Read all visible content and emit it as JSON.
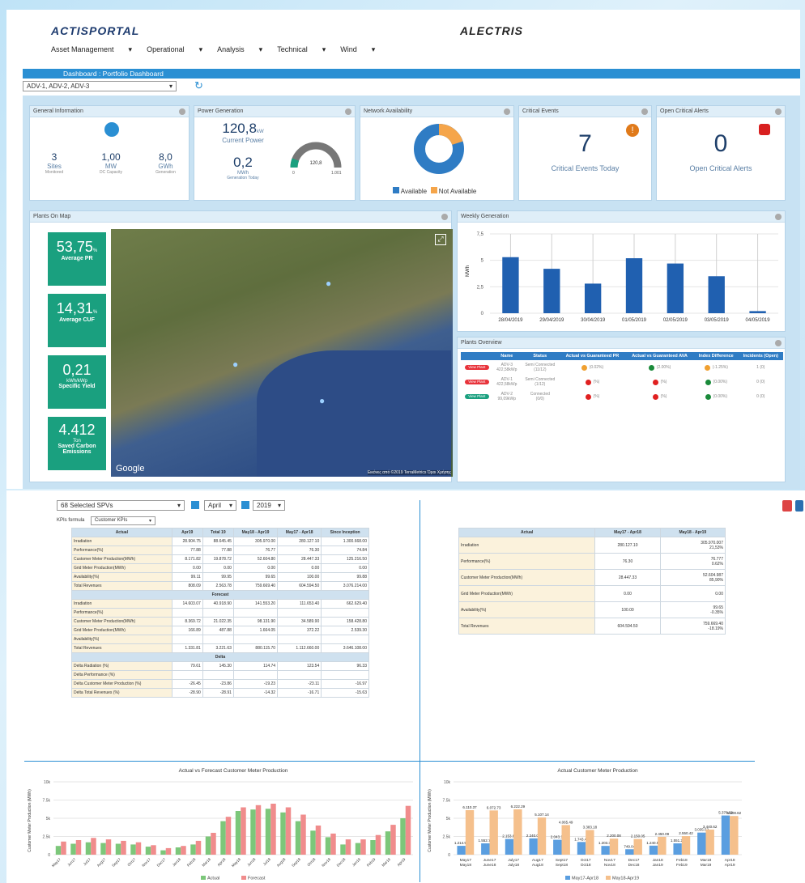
{
  "header": {
    "logo_left": "ACTISPORTAL",
    "logo_right": "ALECTRIS",
    "nav": [
      "Asset Management",
      "Operational",
      "Analysis",
      "Technical",
      "Wind"
    ],
    "breadcrumb": "Dashboard : Portfolio Dashboard",
    "portfolio_select": "ADV-1, ADV-2, ADV-3"
  },
  "general": {
    "title": "General Information",
    "sites": "3",
    "sites_lbl": "Sites",
    "sites_sub": "Monitored",
    "mw": "1,00",
    "mw_lbl": "MW",
    "mw_sub": "DC Capacity",
    "gwh": "8,0",
    "gwh_lbl": "GWh",
    "gwh_sub": "Generation"
  },
  "power": {
    "title": "Power Generation",
    "current": "120,8",
    "current_unit": "kW",
    "current_lbl": "Current Power",
    "today": "0,2",
    "today_unit": "MWh",
    "today_lbl": "Generation Today",
    "gauge_val": "120,8",
    "gauge_min": "0",
    "gauge_max": "1.001",
    "gauge_level": 0.12
  },
  "network": {
    "title": "Network Availability",
    "available": "Available",
    "not_available": "Not Available",
    "available_share": 0.8
  },
  "critical": {
    "title": "Critical Events",
    "value": "7",
    "label": "Critical Events Today"
  },
  "alerts": {
    "title": "Open Critical Alerts",
    "value": "0",
    "label": "Open Critical Alerts"
  },
  "map": {
    "title": "Plants On Map",
    "google": "Google",
    "attribution": "Εικόνες από ©2019 TerraMetrics  Όροι Χρήσης"
  },
  "kpis": [
    {
      "value": "53,75",
      "unit": "%",
      "label": "Average PR"
    },
    {
      "value": "14,31",
      "unit": "%",
      "label": "Average CUF"
    },
    {
      "value": "0,21",
      "unit": "kWh/kWp",
      "label": "Specific Yield"
    },
    {
      "value": "4.412",
      "unit": "Ton",
      "label": "Saved Carbon Emissions"
    }
  ],
  "weekly": {
    "title": "Weekly Generation",
    "ylabel": "MWh"
  },
  "overview": {
    "title": "Plants Overview",
    "headers": [
      "",
      "Name",
      "Status",
      "Actual vs Guaranteed PR",
      "Actual vs Guaranteed AVA",
      "Index Difference",
      "Incidents (Open)"
    ],
    "rows": [
      {
        "btn": "View Plant",
        "btn_color": "#e8333b",
        "name": "ADV-3\n422,58kWp",
        "status": "Semi Connected\n(11/12)",
        "pr": "(0.02%)",
        "pr_c": "#f0a030",
        "ava": "(2.00%)",
        "ava_c": "#1a8a3a",
        "idx": "(-1.25%)",
        "idx_c": "#f0a030",
        "inc": "1 (0)"
      },
      {
        "btn": "View Plant",
        "btn_color": "#e8333b",
        "name": "ADV-1\n422,58kWp",
        "status": "Semi Connected\n(1/12)",
        "pr": "(%)",
        "pr_c": "#e02020",
        "ava": "(%)",
        "ava_c": "#e02020",
        "idx": "(0.00%)",
        "idx_c": "#1a8a3a",
        "inc": "0 (0)"
      },
      {
        "btn": "View Plant",
        "btn_color": "#1aa07f",
        "name": "ADV-2\n99,09kWp",
        "status": "Connected\n(0/0)",
        "pr": "(%)",
        "pr_c": "#e02020",
        "ava": "(%)",
        "ava_c": "#e02020",
        "idx": "(0.00%)",
        "idx_c": "#1a8a3a",
        "inc": "0 (0)"
      }
    ]
  },
  "filters": {
    "spvs": "68 Selected SPVs",
    "month": "April",
    "year": "2019",
    "kpi_formula_lbl": "KPIs formula",
    "kpi_formula": "Customer KPIs"
  },
  "left_table": {
    "headers": [
      "Actual",
      "Apr19",
      "Total 19",
      "May18 - Apr19",
      "May17 - Apr18",
      "Since Inception"
    ],
    "actual": [
      [
        "Irradiation",
        "28.904.75",
        "88.645.45",
        "305.970.00",
        "280.127.10",
        "1.300.668.00"
      ],
      [
        "Performance(%)",
        "77.88",
        "77.88",
        "76.77",
        "76.30",
        "74.84"
      ],
      [
        "Customer Meter Production(MWh)",
        "8.171.82",
        "19.878.72",
        "52.604.80",
        "28.447.33",
        "125.216.50"
      ],
      [
        "Grid Meter Production(MWh)",
        "0.00",
        "0.00",
        "0.00",
        "0.00",
        "0.00"
      ],
      [
        "Availability(%)",
        "99.11",
        "99.95",
        "99.65",
        "100.00",
        "99.88"
      ],
      [
        "Total Revenues",
        "808.09",
        "2.563.78",
        "759.669.40",
        "604.594.50",
        "3.076.214.00"
      ]
    ],
    "forecast_lbl": "Forecast",
    "forecast": [
      [
        "Irradiation",
        "14.603.07",
        "40.918.90",
        "141.553.20",
        "111.653.40",
        "662.629.40"
      ],
      [
        "Performance(%)",
        "",
        "",
        "",
        "",
        ""
      ],
      [
        "Customer Meter Production(MWh)",
        "8.369.72",
        "21.022.35",
        "98.131.90",
        "34.589.90",
        "158.428.80"
      ],
      [
        "Grid Meter Production(MWh)",
        "166.89",
        "487.88",
        "1.664.05",
        "372.22",
        "2.539.30"
      ],
      [
        "Availability(%)",
        "",
        "",
        "",
        "",
        ""
      ],
      [
        "Total Revenues",
        "1.331.81",
        "3.221.63",
        "880.115.70",
        "1.112.660.00",
        "3.646.108.00"
      ]
    ],
    "delta_lbl": "Delta",
    "delta": [
      [
        "Delta Radiation (%)",
        "79.61",
        "145.30",
        "114.74",
        "123.54",
        "96.33"
      ],
      [
        "Delta Performance (%)",
        "",
        "",
        "",
        "",
        ""
      ],
      [
        "Delta Customer Meter Production (%)",
        "-26.45",
        "-23.86",
        "-19.23",
        "-23.11",
        "-16.97"
      ],
      [
        "Delta Total Revenues (%)",
        "-28.90",
        "-28.91",
        "-14.32",
        "-16.71",
        "-15.63"
      ]
    ]
  },
  "right_table": {
    "headers": [
      "Actual",
      "May17 - Apr18",
      "May18 - Apr19"
    ],
    "rows": [
      [
        "Irradiation",
        "280.127.10",
        "305.970.007\n21,53%"
      ],
      [
        "Performance(%)",
        "76.30",
        "76.777\n0.62%"
      ],
      [
        "Customer Meter Production(MWh)",
        "28.447.33",
        "52.604.987\n85,90%"
      ],
      [
        "Grid Meter Production(MWh)",
        "0.00",
        "0.00"
      ],
      [
        "Availability(%)",
        "100.00",
        "99.65\n-0.35%"
      ],
      [
        "Total Revenues",
        "604.594.50",
        "759.669.40\n-18.19%"
      ]
    ]
  },
  "chart_data": [
    {
      "type": "bar",
      "title": "",
      "ylabel": "MWh",
      "categories": [
        "28/04/2019",
        "29/04/2019",
        "30/04/2019",
        "01/05/2019",
        "02/05/2019",
        "03/05/2019",
        "04/05/2019"
      ],
      "values": [
        5.3,
        4.2,
        2.8,
        5.2,
        4.7,
        3.5,
        0.2
      ],
      "ylim": [
        0,
        7.5
      ],
      "yticks": [
        "0",
        "2,5",
        "5",
        "7,5"
      ]
    },
    {
      "type": "bar",
      "title": "Actual vs Forecast Customer Meter Production",
      "ylabel": "Customer Meter Production (MWh)",
      "categories": [
        "May17",
        "Jun17",
        "Jul17",
        "Aug17",
        "Sep17",
        "Oct17",
        "Nov17",
        "Dec17",
        "Jan18",
        "Feb18",
        "Mar18",
        "Apr18",
        "May18",
        "Jun18",
        "Jul18",
        "Aug18",
        "Sep18",
        "Oct18",
        "Nov18",
        "Dec18",
        "Jan19",
        "Feb19",
        "Mar19",
        "Apr19"
      ],
      "ylim": [
        0,
        10000
      ],
      "yticks": [
        "0",
        "2.5k",
        "5k",
        "7.5k",
        "10k"
      ],
      "series": [
        {
          "name": "Actual",
          "color": "#7cc77a",
          "values": [
            1200,
            1500,
            1700,
            1600,
            1500,
            1400,
            1100,
            600,
            1000,
            1400,
            2500,
            4600,
            6000,
            6200,
            6300,
            5800,
            4600,
            3300,
            2400,
            1400,
            1600,
            2000,
            3200,
            5000
          ]
        },
        {
          "name": "Forecast",
          "color": "#f08c8c",
          "values": [
            1800,
            2000,
            2300,
            2100,
            1900,
            1700,
            1300,
            900,
            1200,
            1900,
            3000,
            5200,
            6500,
            6800,
            7000,
            6500,
            5500,
            4000,
            2900,
            2100,
            2100,
            2700,
            4100,
            6700
          ]
        }
      ]
    },
    {
      "type": "bar",
      "title": "Actual Customer Meter Production",
      "ylabel": "Customer Meter Production (MWh)",
      "categories": [
        "May17\nMay18",
        "June17\nJune18",
        "July17\nJuly18",
        "Aug17\nAug18",
        "Sept17\nSept18",
        "Oct17\nOct18",
        "Nov17\nNov18",
        "Dec17\nDec18",
        "Jan18\nJan19",
        "Feb18\nFeb19",
        "Mar18\nMar19",
        "Apr18\nApr19"
      ],
      "ylim": [
        0,
        10000
      ],
      "yticks": [
        "0",
        "2.5k",
        "5k",
        "7.5k",
        "10k"
      ],
      "series": [
        {
          "name": "May17-Apr18",
          "color": "#5a9ee0",
          "values": [
            1214.91,
            1552.79,
            2153.63,
            2240.04,
            2043.11,
            1743.46,
            1203.36,
            749.04,
            1240.52,
            1551.29,
            3035.52,
            5378.62
          ]
        },
        {
          "name": "May18-Apr19",
          "color": "#f5c08c",
          "values": [
            6110.37,
            6072.73,
            6222.29,
            5107.14,
            4065.49,
            3383.18,
            2200.08,
            2150.05,
            2450.09,
            2550.42,
            3440.62,
            5308.62
          ]
        }
      ]
    }
  ]
}
